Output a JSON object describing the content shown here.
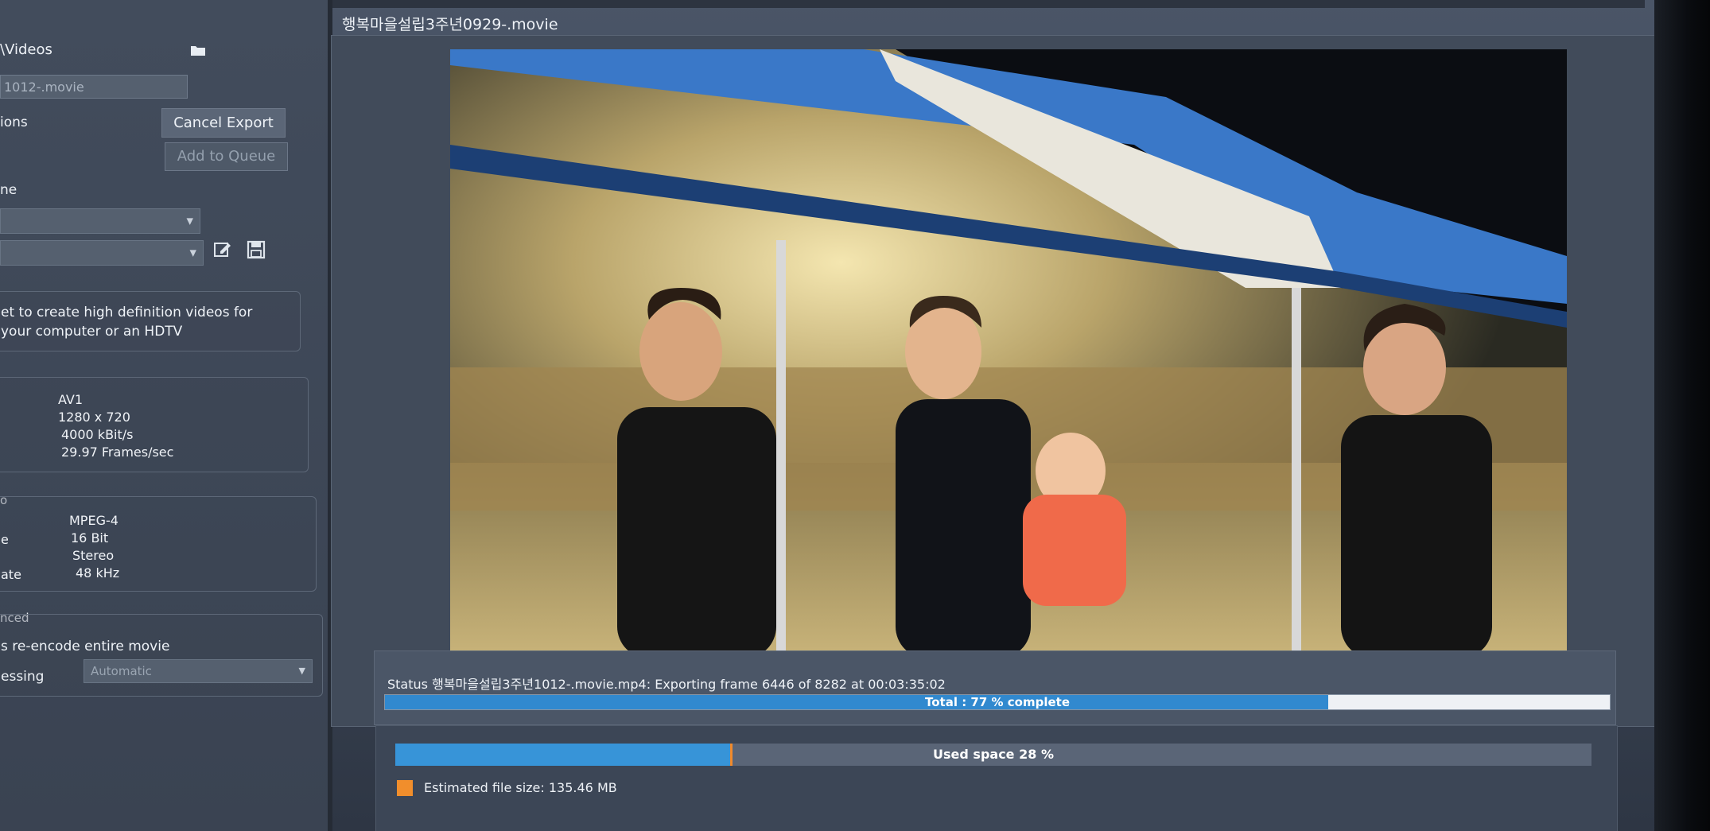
{
  "left_panel": {
    "folder_path": "\\Videos",
    "filename_value": "1012-.movie",
    "options_label": "ions",
    "cancel_export_label": "Cancel Export",
    "add_to_queue_label": "Add to Queue",
    "preset_label": "ne",
    "description_line1": "et to create high definition videos for",
    "description_line2": "your computer or an HDTV",
    "video_specs": {
      "codec": "AV1",
      "resolution": "1280 x 720",
      "bitrate": "4000 kBit/s",
      "framerate": "29.97 Frames/sec"
    },
    "audio_label": "o",
    "audio_specs": {
      "codec_label": "",
      "codec": "MPEG-4",
      "size_label": "e",
      "size": "16 Bit",
      "channels": "Stereo",
      "rate_label": "ate",
      "rate": "48 kHz"
    },
    "advanced_label": "nced",
    "reencode_label": "s re-encode entire movie",
    "processing_label": "essing",
    "processing_value": "Automatic"
  },
  "main": {
    "movie_title": "행복마을설립3주년0929-.movie",
    "status_text": "Status 행복마을설립3주년1012-.movie.mp4: Exporting frame 6446 of 8282 at 00:03:35:02",
    "total_progress_label": "Total : 77 % complete",
    "total_progress_fraction": 0.77,
    "used_space_label": "Used space 28 %",
    "used_space_fraction": 0.28,
    "estimated_size_label": "Estimated file size: 135.46 MB"
  },
  "colors": {
    "progress_fill": "#3189cf",
    "space_fill": "#3794d8",
    "estimate_swatch": "#f18e2c"
  }
}
